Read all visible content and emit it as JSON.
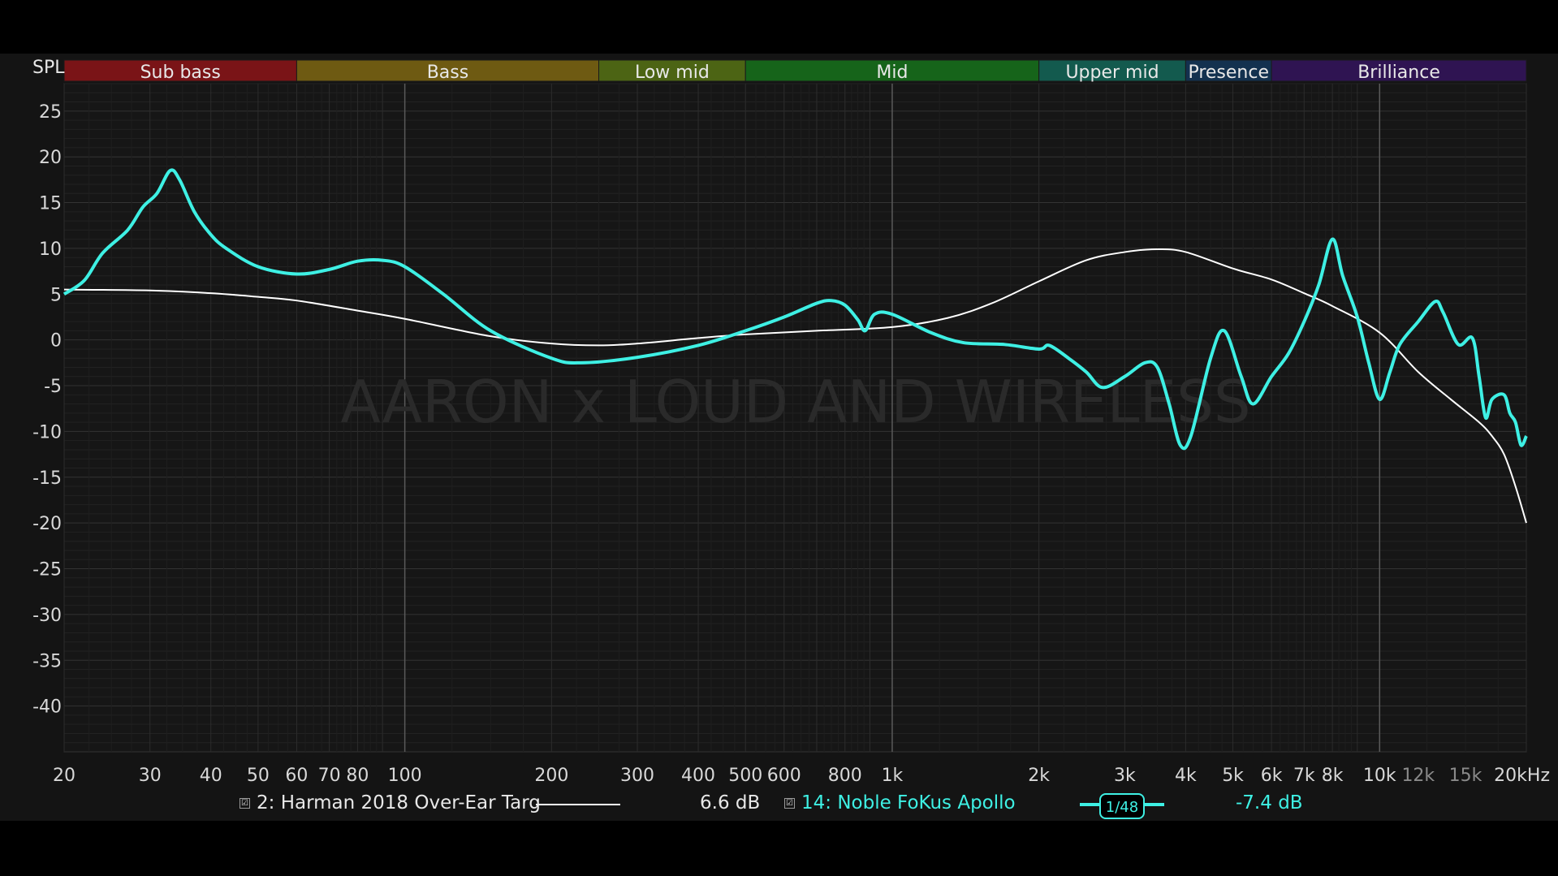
{
  "spl_label": "SPL",
  "watermark": "AARON x LOUD AND WIRELESS",
  "bands": [
    {
      "name": "Sub bass",
      "from": 20,
      "to": 60,
      "color": "#7a1417"
    },
    {
      "name": "Bass",
      "from": 60,
      "to": 250,
      "color": "#6e5a12"
    },
    {
      "name": "Low mid",
      "from": 250,
      "to": 500,
      "color": "#4c6414"
    },
    {
      "name": "Mid",
      "from": 500,
      "to": 2000,
      "color": "#16641a"
    },
    {
      "name": "Upper mid",
      "from": 2000,
      "to": 4000,
      "color": "#135a4e"
    },
    {
      "name": "Presence",
      "from": 4000,
      "to": 6000,
      "color": "#13314f"
    },
    {
      "name": "Brilliance",
      "from": 6000,
      "to": 20000,
      "color": "#2f1452"
    }
  ],
  "legend": {
    "target": {
      "label": "2: Harman 2018 Over-Ear Targ",
      "offset": "6.6 dB",
      "color": "#ffffff",
      "checked": "☑"
    },
    "measurement": {
      "label": "14: Noble FoKus Apollo",
      "offset": "-7.4 dB",
      "color": "#3ef0e4",
      "checked": "☑",
      "smoothing": "1/48"
    }
  },
  "chart_data": {
    "type": "line",
    "x_scale": "log",
    "xlim": [
      20,
      20000
    ],
    "ylim": [
      -45,
      28
    ],
    "y_ticks": [
      25,
      20,
      15,
      10,
      5,
      0,
      -5,
      -10,
      -15,
      -20,
      -25,
      -30,
      -35,
      -40
    ],
    "x_ticks": [
      {
        "v": 20,
        "label": "20"
      },
      {
        "v": 30,
        "label": "30"
      },
      {
        "v": 40,
        "label": "40"
      },
      {
        "v": 50,
        "label": "50"
      },
      {
        "v": 60,
        "label": "60"
      },
      {
        "v": 70,
        "label": "70"
      },
      {
        "v": 80,
        "label": "80"
      },
      {
        "v": 100,
        "label": "100"
      },
      {
        "v": 200,
        "label": "200"
      },
      {
        "v": 300,
        "label": "300"
      },
      {
        "v": 400,
        "label": "400"
      },
      {
        "v": 500,
        "label": "500"
      },
      {
        "v": 600,
        "label": "600"
      },
      {
        "v": 800,
        "label": "800"
      },
      {
        "v": 1000,
        "label": "1k"
      },
      {
        "v": 2000,
        "label": "2k"
      },
      {
        "v": 3000,
        "label": "3k"
      },
      {
        "v": 4000,
        "label": "4k"
      },
      {
        "v": 5000,
        "label": "5k"
      },
      {
        "v": 6000,
        "label": "6k"
      },
      {
        "v": 7000,
        "label": "7k"
      },
      {
        "v": 8000,
        "label": "8k"
      },
      {
        "v": 10000,
        "label": "10k"
      },
      {
        "v": 12000,
        "label": "12k",
        "dim": true
      },
      {
        "v": 15000,
        "label": "15k",
        "dim": true
      },
      {
        "v": 20000,
        "label": "20kHz"
      }
    ],
    "series": [
      {
        "name": "2: Harman 2018 Over-Ear Targ",
        "color": "#ffffff",
        "points": [
          [
            20,
            5.5
          ],
          [
            30,
            5.4
          ],
          [
            40,
            5.1
          ],
          [
            50,
            4.7
          ],
          [
            60,
            4.3
          ],
          [
            80,
            3.2
          ],
          [
            100,
            2.3
          ],
          [
            150,
            0.4
          ],
          [
            200,
            -0.4
          ],
          [
            250,
            -0.6
          ],
          [
            300,
            -0.4
          ],
          [
            400,
            0.2
          ],
          [
            500,
            0.6
          ],
          [
            700,
            1.0
          ],
          [
            1000,
            1.4
          ],
          [
            1300,
            2.4
          ],
          [
            1600,
            4.0
          ],
          [
            2000,
            6.4
          ],
          [
            2500,
            8.7
          ],
          [
            3000,
            9.6
          ],
          [
            3500,
            9.9
          ],
          [
            4000,
            9.6
          ],
          [
            5000,
            7.8
          ],
          [
            6000,
            6.6
          ],
          [
            7000,
            5.1
          ],
          [
            8000,
            3.7
          ],
          [
            10000,
            0.8
          ],
          [
            12000,
            -3.5
          ],
          [
            14000,
            -6.5
          ],
          [
            16000,
            -9.0
          ],
          [
            17000,
            -10.5
          ],
          [
            18000,
            -12.5
          ],
          [
            19000,
            -16.0
          ],
          [
            20000,
            -20.0
          ]
        ]
      },
      {
        "name": "14: Noble FoKus Apollo",
        "color": "#3ef0e4",
        "points": [
          [
            20,
            5.0
          ],
          [
            22,
            6.5
          ],
          [
            24,
            9.5
          ],
          [
            27,
            12.0
          ],
          [
            29,
            14.5
          ],
          [
            31,
            16.0
          ],
          [
            33,
            18.5
          ],
          [
            34.5,
            17.5
          ],
          [
            37,
            14.0
          ],
          [
            40,
            11.5
          ],
          [
            43,
            10.0
          ],
          [
            50,
            8.0
          ],
          [
            60,
            7.2
          ],
          [
            70,
            7.7
          ],
          [
            80,
            8.6
          ],
          [
            90,
            8.7
          ],
          [
            100,
            8.0
          ],
          [
            120,
            5.0
          ],
          [
            150,
            1.0
          ],
          [
            200,
            -2.0
          ],
          [
            230,
            -2.5
          ],
          [
            300,
            -1.9
          ],
          [
            400,
            -0.6
          ],
          [
            500,
            1.0
          ],
          [
            600,
            2.5
          ],
          [
            700,
            4.0
          ],
          [
            750,
            4.3
          ],
          [
            800,
            3.8
          ],
          [
            850,
            2.2
          ],
          [
            880,
            1.0
          ],
          [
            920,
            2.8
          ],
          [
            1000,
            2.8
          ],
          [
            1200,
            0.8
          ],
          [
            1400,
            -0.3
          ],
          [
            1700,
            -0.5
          ],
          [
            2000,
            -1.0
          ],
          [
            2100,
            -0.6
          ],
          [
            2300,
            -2.0
          ],
          [
            2500,
            -3.5
          ],
          [
            2700,
            -5.2
          ],
          [
            3000,
            -4.0
          ],
          [
            3300,
            -2.5
          ],
          [
            3500,
            -3.0
          ],
          [
            3700,
            -7.0
          ],
          [
            3900,
            -11.5
          ],
          [
            4100,
            -10.5
          ],
          [
            4500,
            -2.0
          ],
          [
            4800,
            1.0
          ],
          [
            5200,
            -4.0
          ],
          [
            5500,
            -7.0
          ],
          [
            6000,
            -4.0
          ],
          [
            6500,
            -1.5
          ],
          [
            7000,
            2.0
          ],
          [
            7500,
            6.0
          ],
          [
            8000,
            11.0
          ],
          [
            8400,
            7.0
          ],
          [
            9000,
            2.5
          ],
          [
            9500,
            -2.5
          ],
          [
            10000,
            -6.5
          ],
          [
            10500,
            -3.5
          ],
          [
            11000,
            -0.5
          ],
          [
            12000,
            2.0
          ],
          [
            13000,
            4.2
          ],
          [
            13500,
            3.0
          ],
          [
            14500,
            -0.5
          ],
          [
            15500,
            0.2
          ],
          [
            16000,
            -4.0
          ],
          [
            16500,
            -8.5
          ],
          [
            17000,
            -6.5
          ],
          [
            18000,
            -6.0
          ],
          [
            18500,
            -8.0
          ],
          [
            19000,
            -9.0
          ],
          [
            19500,
            -11.5
          ],
          [
            20000,
            -10.5
          ]
        ]
      }
    ]
  }
}
